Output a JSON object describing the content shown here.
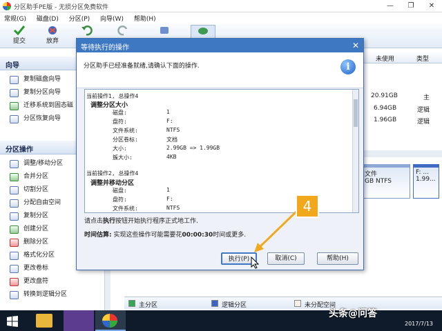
{
  "window": {
    "title": "分区助手PE版 - 无损分区免费软件"
  },
  "menu": [
    "常规(G)",
    "磁盘(D)",
    "分区(P)",
    "向导(W)",
    "帮助(H)"
  ],
  "toolbar": {
    "commit": "提交",
    "discard": "放弃",
    "undo": "撤销",
    "redo": "重做",
    "refresh": "刷新",
    "disk": "磁盘"
  },
  "wizard": {
    "title": "向导",
    "items": [
      "复制磁盘向导",
      "复制分区向导",
      "迁移系统到固态磁",
      "分区恢复向导"
    ]
  },
  "partition_ops": {
    "title": "分区操作",
    "items": [
      "调整/移动分区",
      "合并分区",
      "切割分区",
      "分配自由空间",
      "复制分区",
      "创建分区",
      "删除分区",
      "格式化分区",
      "更改卷标",
      "更改盘符",
      "转换到逻辑分区"
    ]
  },
  "table": {
    "headers": [
      "未使用",
      "类型"
    ],
    "rows": [
      [
        "20.91GB",
        "主"
      ],
      [
        "6.94GB",
        "逻辑"
      ],
      [
        "1.96GB",
        "逻辑"
      ]
    ]
  },
  "diskmap": {
    "blocks": [
      {
        "l1": "文件",
        "l2": "GB NTFS"
      },
      {
        "l1": "F: ...",
        "l2": "1.99..."
      }
    ]
  },
  "legend": {
    "primary": "主分区",
    "logical": "逻辑分区",
    "unallocated": "未分配空间"
  },
  "dialog": {
    "title": "等待执行的操作",
    "message": "分区助手已经准备就绪,请确认下面的操作.",
    "op1": {
      "header": "当前操作1, 总操作4",
      "name": "调整分区大小",
      "rows": [
        [
          "磁盘:",
          "1"
        ],
        [
          "盘符:",
          "F:"
        ],
        [
          "文件系统:",
          "NTFS"
        ],
        [
          "分区卷标:",
          "文档"
        ],
        [
          "大小:",
          "2.99GB => 1.99GB"
        ],
        [
          "簇大小:",
          "4KB"
        ]
      ]
    },
    "op2": {
      "header": "当前操作2, 总操作4",
      "name": "调整并移动分区",
      "rows": [
        [
          "磁盘:",
          "1"
        ],
        [
          "盘符:",
          "F:"
        ],
        [
          "文件系统:",
          "NTFS"
        ]
      ]
    },
    "hint_pre": "请点击",
    "hint_bold": "执行",
    "hint_post": "按钮开始执行程序正式地工作.",
    "time_label": "时间估算:",
    "time_pre": "实现这些操作可能需要花",
    "time_value": "00:00:30",
    "time_post": "时间或更多.",
    "buttons": {
      "execute": "执行(P)",
      "cancel": "取消(C)",
      "help": "帮助(H)"
    }
  },
  "annotation": {
    "step": "4"
  },
  "watermark": "头条@问答",
  "clock": {
    "date": "2017/7/13"
  },
  "colors": {
    "accent": "#3f78c2",
    "badge": "#f2a81d",
    "primary": "#32a852",
    "logical": "#3a62c9"
  }
}
